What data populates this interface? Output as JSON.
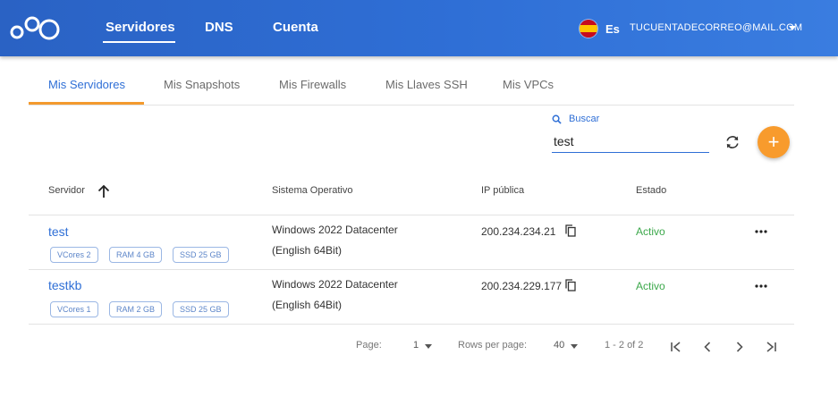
{
  "header": {
    "nav": [
      "Servidores",
      "DNS",
      "Cuenta"
    ],
    "language": "Es",
    "account": "TUCUENTADECORREO@MAIL.COM"
  },
  "tabs": [
    "Mis Servidores",
    "Mis Snapshots",
    "Mis Firewalls",
    "Mis Llaves SSH",
    "Mis VPCs"
  ],
  "search": {
    "label": "Buscar",
    "value": "test"
  },
  "fab_label": "+",
  "table": {
    "headers": [
      "Servidor",
      "Sistema Operativo",
      "IP pública",
      "Estado"
    ],
    "rows": [
      {
        "name": "test",
        "chips": [
          "VCores  2",
          "RAM  4 GB",
          "SSD  25 GB"
        ],
        "os_line1": "Windows 2022 Datacenter",
        "os_line2": "(English 64Bit)",
        "ip": "200.234.234.21",
        "status": "Activo"
      },
      {
        "name": "testkb",
        "chips": [
          "VCores  1",
          "RAM  2 GB",
          "SSD  25 GB"
        ],
        "os_line1": "Windows 2022 Datacenter",
        "os_line2": "(English 64Bit)",
        "ip": "200.234.229.177",
        "status": "Activo"
      }
    ]
  },
  "pagination": {
    "page_label": "Page:",
    "page_value": "1",
    "rows_label": "Rows per page:",
    "rows_value": "40",
    "range": "1 - 2 of 2"
  },
  "colors": {
    "primary": "#2f6fd6",
    "accent": "#f39a2e",
    "status_active": "#3ca84b"
  }
}
